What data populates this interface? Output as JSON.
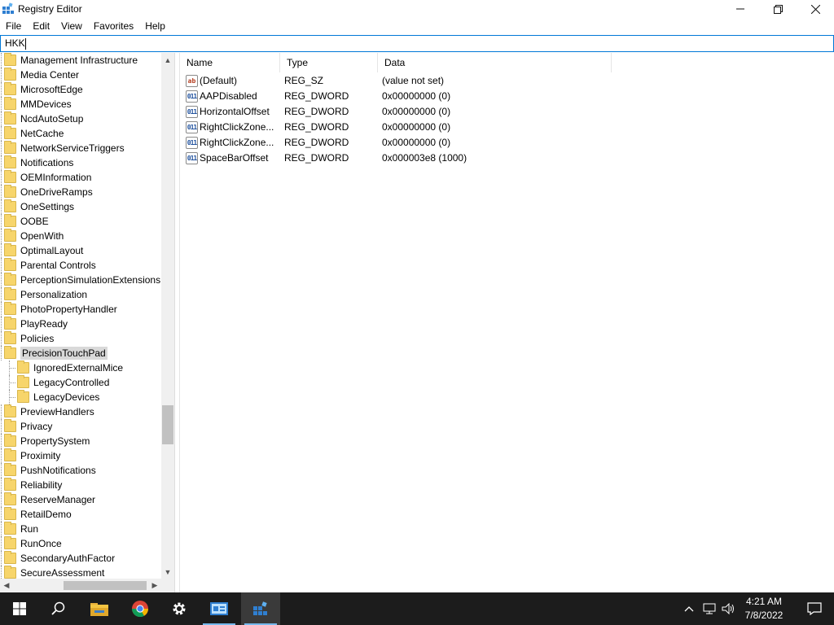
{
  "window": {
    "title": "Registry Editor",
    "minimize_icon": "minimize-icon",
    "maximize_icon": "restore-icon",
    "close_icon": "close-icon"
  },
  "menu": [
    "File",
    "Edit",
    "View",
    "Favorites",
    "Help"
  ],
  "address": {
    "value": "HKK"
  },
  "tree": {
    "items": [
      {
        "label": "Management Infrastructure",
        "level": 0
      },
      {
        "label": "Media Center",
        "level": 0
      },
      {
        "label": "MicrosoftEdge",
        "level": 0
      },
      {
        "label": "MMDevices",
        "level": 0
      },
      {
        "label": "NcdAutoSetup",
        "level": 0
      },
      {
        "label": "NetCache",
        "level": 0
      },
      {
        "label": "NetworkServiceTriggers",
        "level": 0
      },
      {
        "label": "Notifications",
        "level": 0
      },
      {
        "label": "OEMInformation",
        "level": 0
      },
      {
        "label": "OneDriveRamps",
        "level": 0
      },
      {
        "label": "OneSettings",
        "level": 0
      },
      {
        "label": "OOBE",
        "level": 0
      },
      {
        "label": "OpenWith",
        "level": 0
      },
      {
        "label": "OptimalLayout",
        "level": 0
      },
      {
        "label": "Parental Controls",
        "level": 0
      },
      {
        "label": "PerceptionSimulationExtensions",
        "level": 0
      },
      {
        "label": "Personalization",
        "level": 0
      },
      {
        "label": "PhotoPropertyHandler",
        "level": 0
      },
      {
        "label": "PlayReady",
        "level": 0
      },
      {
        "label": "Policies",
        "level": 0
      },
      {
        "label": "PrecisionTouchPad",
        "level": 0,
        "selected": true
      },
      {
        "label": "IgnoredExternalMice",
        "level": 1
      },
      {
        "label": "LegacyControlled",
        "level": 1
      },
      {
        "label": "LegacyDevices",
        "level": 1
      },
      {
        "label": "PreviewHandlers",
        "level": 0
      },
      {
        "label": "Privacy",
        "level": 0
      },
      {
        "label": "PropertySystem",
        "level": 0
      },
      {
        "label": "Proximity",
        "level": 0
      },
      {
        "label": "PushNotifications",
        "level": 0
      },
      {
        "label": "Reliability",
        "level": 0
      },
      {
        "label": "ReserveManager",
        "level": 0
      },
      {
        "label": "RetailDemo",
        "level": 0
      },
      {
        "label": "Run",
        "level": 0
      },
      {
        "label": "RunOnce",
        "level": 0
      },
      {
        "label": "SecondaryAuthFactor",
        "level": 0
      },
      {
        "label": "SecureAssessment",
        "level": 0
      }
    ]
  },
  "values": {
    "columns": [
      "Name",
      "Type",
      "Data"
    ],
    "rows": [
      {
        "icon": "string-value-icon",
        "name": "(Default)",
        "type": "REG_SZ",
        "data": "(value not set)"
      },
      {
        "icon": "dword-value-icon",
        "name": "AAPDisabled",
        "type": "REG_DWORD",
        "data": "0x00000000 (0)"
      },
      {
        "icon": "dword-value-icon",
        "name": "HorizontalOffset",
        "type": "REG_DWORD",
        "data": "0x00000000 (0)"
      },
      {
        "icon": "dword-value-icon",
        "name": "RightClickZone...",
        "type": "REG_DWORD",
        "data": "0x00000000 (0)"
      },
      {
        "icon": "dword-value-icon",
        "name": "RightClickZone...",
        "type": "REG_DWORD",
        "data": "0x00000000 (0)"
      },
      {
        "icon": "dword-value-icon",
        "name": "SpaceBarOffset",
        "type": "REG_DWORD",
        "data": "0x000003e8 (1000)"
      }
    ],
    "string_icon_text": "ab",
    "dword_icon_text": "011"
  },
  "taskbar": {
    "apps": [
      "start-icon",
      "search-icon",
      "file-explorer-icon",
      "chrome-icon",
      "settings-icon",
      "control-panel-icon",
      "registry-editor-icon"
    ],
    "time": "4:21 AM",
    "date": "7/8/2022",
    "accent": "#76b9ed"
  }
}
